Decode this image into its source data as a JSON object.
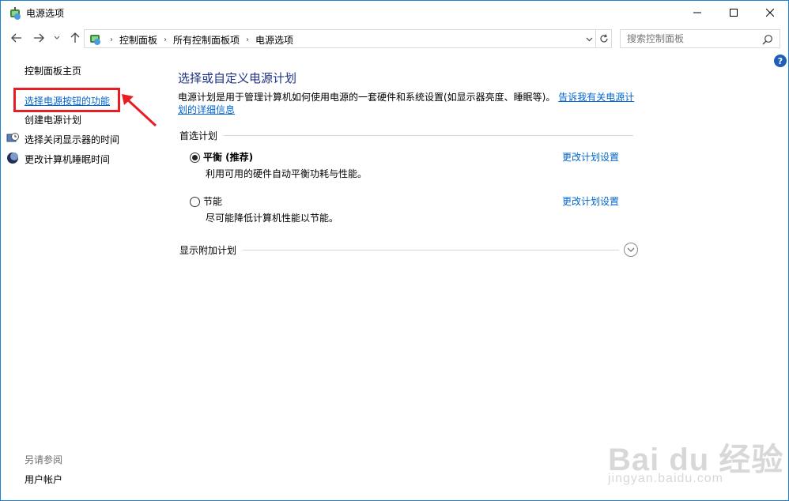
{
  "window": {
    "title": "电源选项"
  },
  "nav": {
    "breadcrumbs": [
      "控制面板",
      "所有控制面板项",
      "电源选项"
    ],
    "search_placeholder": "搜索控制面板"
  },
  "sidebar": {
    "home": "控制面板主页",
    "items": [
      {
        "label": "选择电源按钮的功能",
        "highlighted": true
      },
      {
        "label": "创建电源计划"
      },
      {
        "label": "选择关闭显示器的时间"
      },
      {
        "label": "更改计算机睡眠时间"
      }
    ],
    "see_also": "另请参阅",
    "user_accounts": "用户帐户"
  },
  "main": {
    "title": "选择或自定义电源计划",
    "description": "电源计划是用于管理计算机如何使用电源的一套硬件和系统设置(如显示器亮度、睡眠等)。",
    "description_link": "告诉我有关电源计划的详细信息",
    "preferred_group": "首选计划",
    "plans": [
      {
        "name": "平衡 (推荐)",
        "desc": "利用可用的硬件自动平衡功耗与性能。",
        "link": "更改计划设置",
        "selected": true
      },
      {
        "name": "节能",
        "desc": "尽可能降低计算机性能以节能。",
        "link": "更改计划设置",
        "selected": false
      }
    ],
    "more_group": "显示附加计划"
  },
  "help_icon": "?",
  "watermark": {
    "brand": "Bai du 经验",
    "url": "jingyan.baidu.com"
  },
  "colors": {
    "link": "#0066cc",
    "title": "#1e3287",
    "highlight": "#e81e25"
  }
}
